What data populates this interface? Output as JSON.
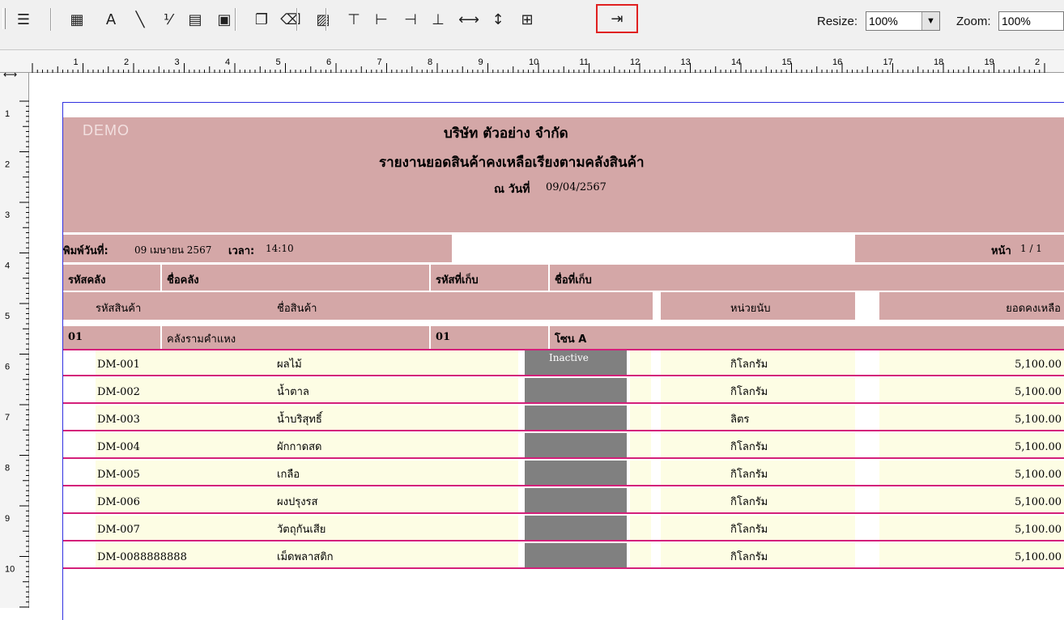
{
  "toolbar": {
    "buttons": [
      {
        "name": "properties-icon",
        "glyph": "☰"
      },
      {
        "name": "table-icon",
        "glyph": "▦"
      },
      {
        "name": "text-icon",
        "glyph": "A"
      },
      {
        "name": "line-icon",
        "glyph": "╲"
      },
      {
        "name": "formula-icon",
        "glyph": "⅟"
      },
      {
        "name": "database-field-icon",
        "glyph": "▤"
      },
      {
        "name": "image-icon",
        "glyph": "▣"
      },
      {
        "name": "copy-icon",
        "glyph": "❐"
      },
      {
        "name": "eraser-icon",
        "glyph": "⌫"
      },
      {
        "name": "edit-image-icon",
        "glyph": "▨"
      },
      {
        "name": "align-top-icon",
        "glyph": "⊤"
      },
      {
        "name": "align-left-icon",
        "glyph": "⊢"
      },
      {
        "name": "align-right-icon",
        "glyph": "⊣"
      },
      {
        "name": "align-bottom-icon",
        "glyph": "⊥"
      },
      {
        "name": "same-width-icon",
        "glyph": "⟷"
      },
      {
        "name": "same-height-icon",
        "glyph": "↕"
      },
      {
        "name": "same-size-icon",
        "glyph": "⊞"
      },
      {
        "name": "exit-icon",
        "glyph": "⇥"
      }
    ],
    "resize_label": "Resize:",
    "resize_value": "100%",
    "zoom_label": "Zoom:",
    "zoom_value": "100%"
  },
  "ruler": {
    "h_numbers": [
      "1",
      "2",
      "3",
      "4",
      "5",
      "6",
      "7",
      "8",
      "9",
      "10",
      "11",
      "12",
      "13",
      "14",
      "15",
      "16",
      "17",
      "18",
      "19",
      "2"
    ],
    "v_numbers": [
      "1",
      "2",
      "3",
      "4",
      "5",
      "6",
      "7",
      "8",
      "9",
      "10"
    ]
  },
  "report": {
    "watermark": "DEMO",
    "company": "บริษัท ตัวอย่าง จำกัด",
    "title": "รายงานยอดสินค้าคงเหลือเรียงตามคลังสินค้า",
    "as_of_label": "ณ วันที่",
    "as_of_date": "09/04/2567",
    "print_label": "พิมพ์วันที่:",
    "print_date": "09 เมษายน 2567",
    "time_label": "เวลา:",
    "time_value": "14:10",
    "page_label": "หน้า",
    "page_value": "1 / 1",
    "headers": {
      "warehouse_code": "รหัสคลัง",
      "warehouse_name": "ชื่อคลัง",
      "location_code": "รหัสที่เก็บ",
      "location_name": "ชื่อที่เก็บ",
      "product_code": "รหัสสินค้า",
      "product_name": "ชื่อสินค้า",
      "unit": "หน่วยนับ",
      "balance": "ยอดคงเหลือ"
    },
    "group": {
      "warehouse_code": "01",
      "warehouse_name": "คลังรามคำแหง",
      "location_code": "01",
      "location_name": "โซน A"
    },
    "rows": [
      {
        "code": "DM-001",
        "name": "ผลไม้",
        "status": "Inactive",
        "unit": "กิโลกรัม",
        "balance": "5,100.00"
      },
      {
        "code": "DM-002",
        "name": "น้ำตาล",
        "status": "",
        "unit": "กิโลกรัม",
        "balance": "5,100.00"
      },
      {
        "code": "DM-003",
        "name": "น้ำบริสุทธิ์",
        "status": "",
        "unit": "ลิตร",
        "balance": "5,100.00"
      },
      {
        "code": "DM-004",
        "name": "ผักกาดสด",
        "status": "",
        "unit": "กิโลกรัม",
        "balance": "5,100.00"
      },
      {
        "code": "DM-005",
        "name": "เกลือ",
        "status": "",
        "unit": "กิโลกรัม",
        "balance": "5,100.00"
      },
      {
        "code": "DM-006",
        "name": "ผงปรุงรส",
        "status": "",
        "unit": "กิโลกรัม",
        "balance": "5,100.00"
      },
      {
        "code": "DM-007",
        "name": "วัตถุกันเสีย",
        "status": "",
        "unit": "กิโลกรัม",
        "balance": "5,100.00"
      },
      {
        "code": "DM-0088888888",
        "name": "เม็ดพลาสติก",
        "status": "",
        "unit": "กิโลกรัม",
        "balance": "5,100.00"
      }
    ]
  }
}
